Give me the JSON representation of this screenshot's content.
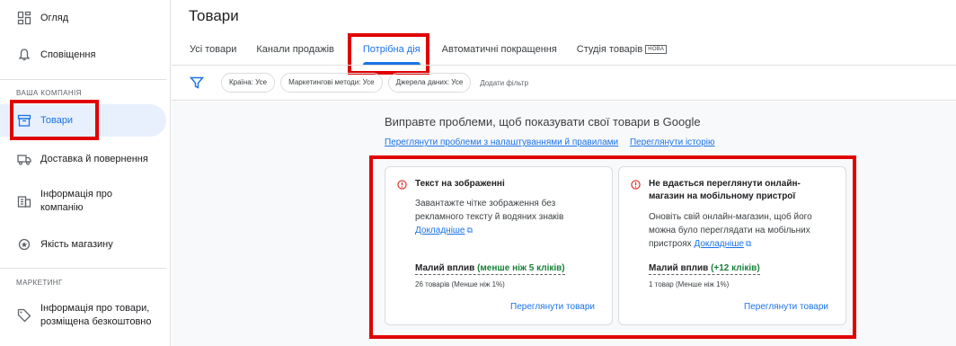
{
  "sidebar": {
    "items_top": [
      {
        "label": "Огляд",
        "icon": "overview-icon"
      },
      {
        "label": "Сповіщення",
        "icon": "bell-icon"
      }
    ],
    "section_company": "ВАША КОМПАНІЯ",
    "items_company": [
      {
        "label": "Товари",
        "icon": "products-icon"
      },
      {
        "label": "Доставка й повернення",
        "icon": "truck-icon"
      },
      {
        "label": "Інформація про",
        "label2": "компанію",
        "icon": "building-icon"
      },
      {
        "label": "Якість магазину",
        "icon": "quality-icon"
      }
    ],
    "section_marketing": "МАРКЕТИНГ",
    "items_marketing": [
      {
        "label": "Інформація про товари,",
        "label2": "розміщена безкоштовно",
        "icon": "tag-icon"
      }
    ]
  },
  "header": {
    "title": "Товари",
    "tabs": [
      {
        "label": "Усі товари"
      },
      {
        "label": "Канали продажів"
      },
      {
        "label": "Потрібна дія"
      },
      {
        "label": "Автоматичні покращення"
      },
      {
        "label": "Студія товарів",
        "badge": "НОВА"
      }
    ]
  },
  "filters": {
    "chips": [
      "Країна: Усе",
      "Маркетингові методи: Усе",
      "Джерела даних: Усе"
    ],
    "add_filter": "Додати фільтр"
  },
  "main": {
    "headline": "Виправте проблеми, щоб показувати свої товари в Google",
    "link_issues": "Переглянути проблеми з налаштуваннями й правилами",
    "link_history": "Переглянути історію",
    "cards": [
      {
        "title": "Текст на зображенні",
        "desc_line1": "Завантажте чітке зображення без",
        "desc_line2": "рекламного тексту й водяних знаків",
        "more": "Докладніше",
        "impact": "Малий вплив",
        "impact_detail": "(менше ніж 5 кліків)",
        "count": "26 товарів (Менше ніж 1%)",
        "button": "Переглянути товари"
      },
      {
        "title_line1": "Не вдається переглянути онлайн-",
        "title_line2": "магазин на мобільному пристрої",
        "desc_line1": "Оновіть свій онлайн-магазин, щоб його",
        "desc_line2": "можна було переглядати на мобільних",
        "desc_line3": "пристроях",
        "more": "Докладніше",
        "impact": "Малий вплив",
        "impact_detail": "(+12 кліків)",
        "count": "1 товар (Менше ніж 1%)",
        "button": "Переглянути товари"
      }
    ]
  },
  "colors": {
    "accent": "#1a73e8",
    "highlight": "#e00000",
    "positive": "#188038",
    "error": "#d93025"
  }
}
